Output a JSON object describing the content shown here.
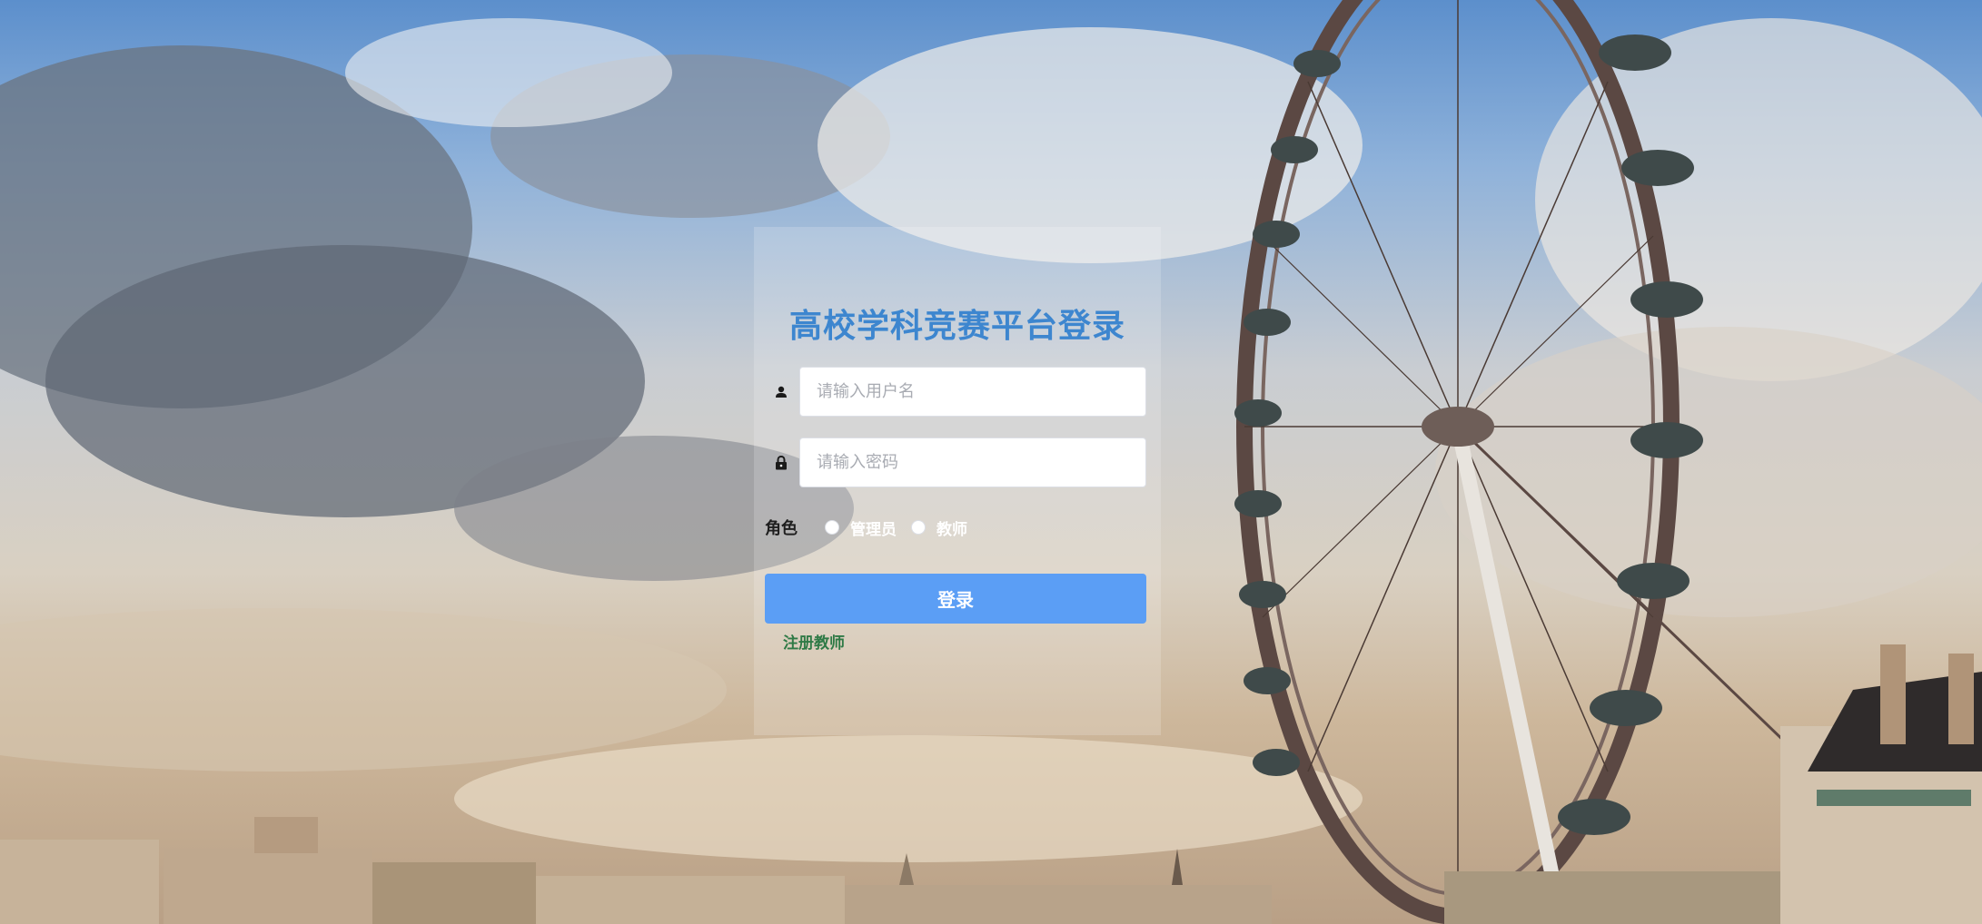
{
  "login": {
    "title": "高校学科竞赛平台登录",
    "username_placeholder": "请输入用户名",
    "password_placeholder": "请输入密码",
    "role_label": "角色",
    "roles": [
      {
        "label": "管理员"
      },
      {
        "label": "教师"
      }
    ],
    "submit_label": "登录",
    "register_label": "注册教师"
  },
  "icons": {
    "username": "user-icon",
    "password": "lock-icon"
  },
  "colors": {
    "title": "#3d86cf",
    "button": "#5b9ef5",
    "register_link": "#2f7a46"
  }
}
